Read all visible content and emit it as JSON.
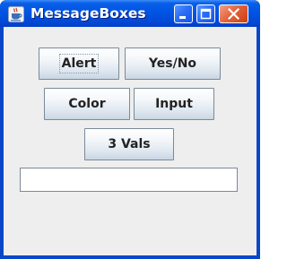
{
  "window": {
    "title": "MessageBoxes",
    "controls": [
      "minimize",
      "maximize",
      "close"
    ]
  },
  "buttons": {
    "alert": "Alert",
    "yes_no": "Yes/No",
    "color": "Color",
    "input": "Input",
    "three_vals": "3 Vals"
  },
  "text_field": {
    "value": ""
  },
  "colors": {
    "titlebar": "#0054e3",
    "close_button": "#e5643b",
    "client_background": "#eeeeee"
  },
  "icons": {
    "app": "java-coffee-cup-icon"
  }
}
